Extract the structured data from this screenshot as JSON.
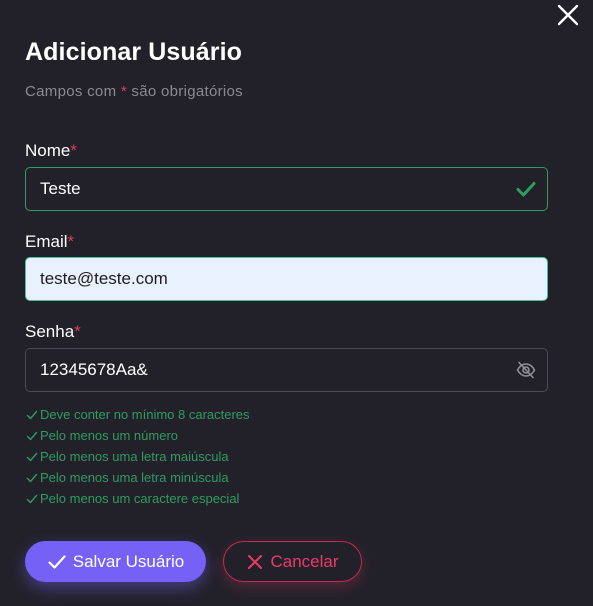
{
  "dialog": {
    "title": "Adicionar Usuário",
    "subtitle_before": "Campos com ",
    "subtitle_star": "*",
    "subtitle_after": " são obrigatórios",
    "close_icon": "close-icon"
  },
  "fields": {
    "nome": {
      "label": "Nome",
      "required_mark": "*",
      "value": "Teste",
      "status_icon": "check-icon",
      "status_color": "#2e9d63"
    },
    "email": {
      "label": "Email",
      "required_mark": "*",
      "value": "teste@teste.com"
    },
    "senha": {
      "label": "Senha",
      "required_mark": "*",
      "value": "12345678Aa&",
      "toggle_icon": "eye-off-icon"
    }
  },
  "password_rules": [
    "Deve conter no mínimo 8 caracteres",
    "Pelo menos um número",
    "Pelo menos uma letra maiúscula",
    "Pelo menos uma letra minúscula",
    "Pelo menos um caractere especial"
  ],
  "actions": {
    "save_label": "Salvar Usuário",
    "save_icon": "check-icon",
    "cancel_label": "Cancelar",
    "cancel_icon": "x-icon"
  },
  "colors": {
    "background": "#222129",
    "accent": "#7561f6",
    "danger": "#ec3a66",
    "success": "#2e9d63"
  }
}
